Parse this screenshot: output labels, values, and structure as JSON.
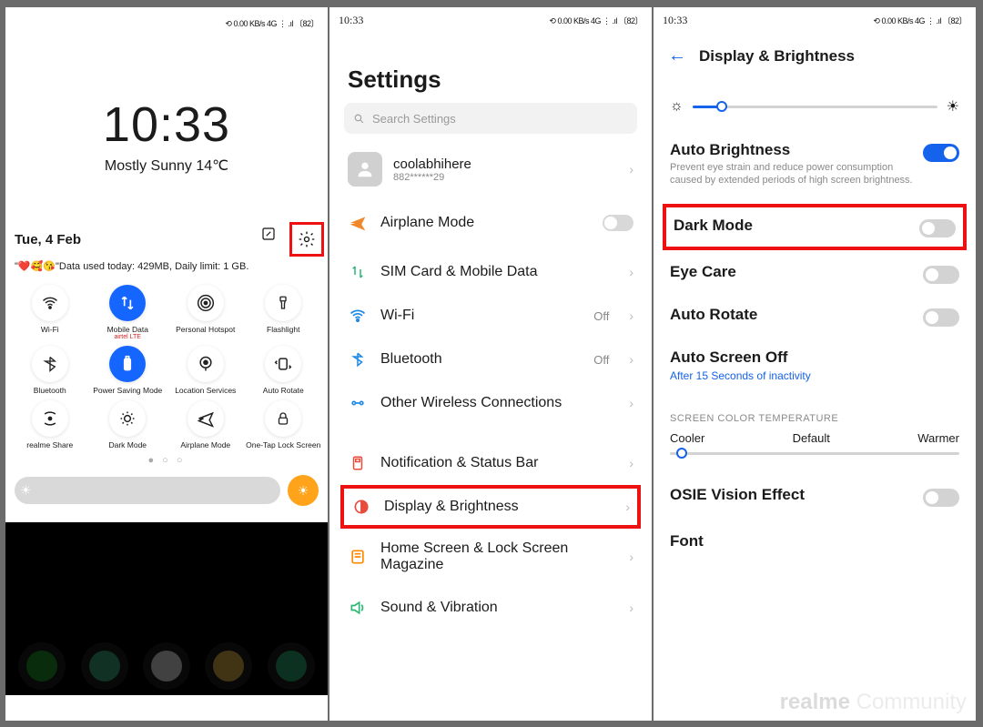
{
  "status": {
    "time": "10:33",
    "icons_text": "⟲ 0.00 KB/s 4G ⋮ .ıl 〔82〕"
  },
  "panel1": {
    "clock": "10:33",
    "weather": "Mostly Sunny 14℃",
    "date": "Tue, 4 Feb",
    "quota": "\"❤️🥰😘\"Data used today: 429MB, Daily limit: 1 GB.",
    "tiles": [
      {
        "label": "Wi-Fi",
        "active": false,
        "icon": "wifi"
      },
      {
        "label": "Mobile Data",
        "sub": "airtel  LTE",
        "active": true,
        "icon": "swap"
      },
      {
        "label": "Personal Hotspot",
        "active": false,
        "icon": "hotspot"
      },
      {
        "label": "Flashlight",
        "active": false,
        "icon": "torch"
      },
      {
        "label": "Bluetooth",
        "active": false,
        "icon": "bt"
      },
      {
        "label": "Power Saving Mode",
        "active": true,
        "icon": "battery"
      },
      {
        "label": "Location Services",
        "active": false,
        "icon": "loc"
      },
      {
        "label": "Auto Rotate",
        "active": false,
        "icon": "rotate"
      },
      {
        "label": "realme Share",
        "active": false,
        "icon": "share"
      },
      {
        "label": "Dark Mode",
        "active": false,
        "icon": "dark"
      },
      {
        "label": "Airplane Mode",
        "active": false,
        "icon": "plane"
      },
      {
        "label": "One-Tap Lock Screen",
        "active": false,
        "icon": "lock"
      }
    ]
  },
  "panel2": {
    "title": "Settings",
    "search_placeholder": "Search Settings",
    "profile": {
      "name": "coolabhihere",
      "number": "882******29"
    },
    "rows": [
      {
        "icon": "plane",
        "label": "Airplane Mode",
        "type": "toggle"
      },
      {
        "icon": "sim",
        "label": "SIM Card & Mobile Data",
        "type": "nav"
      },
      {
        "icon": "wifi",
        "label": "Wi-Fi",
        "type": "nav",
        "value": "Off"
      },
      {
        "icon": "bt",
        "label": "Bluetooth",
        "type": "nav",
        "value": "Off"
      },
      {
        "icon": "wireless",
        "label": "Other Wireless Connections",
        "type": "nav"
      },
      {
        "icon": "notif",
        "label": "Notification & Status Bar",
        "type": "nav"
      },
      {
        "icon": "display",
        "label": "Display & Brightness",
        "type": "nav",
        "highlight": true
      },
      {
        "icon": "home",
        "label": "Home Screen & Lock Screen Magazine",
        "type": "nav",
        "twoline": true
      },
      {
        "icon": "sound",
        "label": "Sound & Vibration",
        "type": "nav"
      }
    ]
  },
  "panel3": {
    "title": "Display & Brightness",
    "auto_brightness": {
      "name": "Auto Brightness",
      "desc": "Prevent eye strain and reduce power consumption caused by extended periods of high screen brightness.",
      "on": true
    },
    "rows": [
      {
        "name": "Dark Mode",
        "on": false,
        "highlight": true
      },
      {
        "name": "Eye Care",
        "on": false
      },
      {
        "name": "Auto Rotate",
        "on": false
      },
      {
        "name": "Auto Screen Off",
        "link": "After 15 Seconds of inactivity"
      }
    ],
    "section_label": "SCREEN COLOR TEMPERATURE",
    "temp_labels": {
      "cool": "Cooler",
      "def": "Default",
      "warm": "Warmer"
    },
    "osie": {
      "name": "OSIE Vision Effect",
      "on": false
    },
    "font_label": "Font"
  },
  "watermark": {
    "brand": "realme",
    "text": "Community"
  }
}
